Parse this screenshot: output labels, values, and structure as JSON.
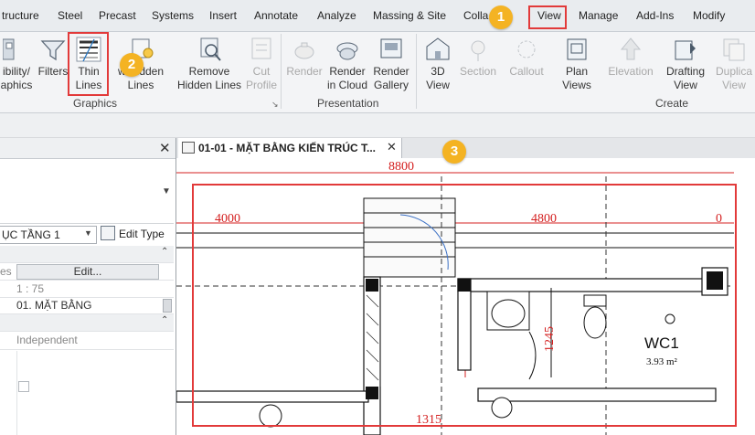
{
  "tabs": [
    "tructure",
    "Steel",
    "Precast",
    "Systems",
    "Insert",
    "Annotate",
    "Analyze",
    "Massing & Site",
    "Colla",
    "View",
    "Manage",
    "Add-Ins",
    "Modify"
  ],
  "ribbon": {
    "graphics": {
      "visibility_label": "ibility/ aphics",
      "filters_label": "Filters",
      "thin_lines_label": "Thin Lines",
      "show_hidden_label": "w Hidden Lines",
      "remove_hidden_label": "Remove Hidden Lines",
      "cut_profile_label": "Cut Profile",
      "group_label": "Graphics"
    },
    "presentation": {
      "render_label": "Render",
      "render_cloud_label": "Render in Cloud",
      "render_gallery_label": "Render Gallery",
      "group_label": "Presentation"
    },
    "create": {
      "view3d_label": "3D View",
      "section_label": "Section",
      "callout_label": "Callout",
      "plan_views_label": "Plan Views",
      "elevation_label": "Elevation",
      "drafting_label": "Drafting View",
      "duplicate_label": "Duplica View",
      "group_label": "Create"
    }
  },
  "properties": {
    "type_value": "ỤC TẦNG 1",
    "edit_type_label": "Edit Type",
    "graphics_prefix": "es",
    "edit_button_label": "Edit...",
    "scale_value": "1 : 75",
    "view_name_value": "01. MẶT BẰNG",
    "dependency_value": "Independent"
  },
  "view_tab": {
    "title": "01-01 - MẶT BẰNG KIẾN TRÚC T..."
  },
  "drawing": {
    "dim_top": "8800",
    "dim_left": "4000",
    "dim_mid": "4800",
    "dim_right": "0",
    "dim_vertical": "1245",
    "dim_bottom": "1315",
    "room_name": "WC1",
    "room_area": "3.93 m²"
  },
  "callouts": [
    "1",
    "2",
    "3"
  ],
  "colors": {
    "accent_red": "#e23a3a",
    "callout_orange": "#f4b323",
    "dim_red": "#d42020"
  }
}
